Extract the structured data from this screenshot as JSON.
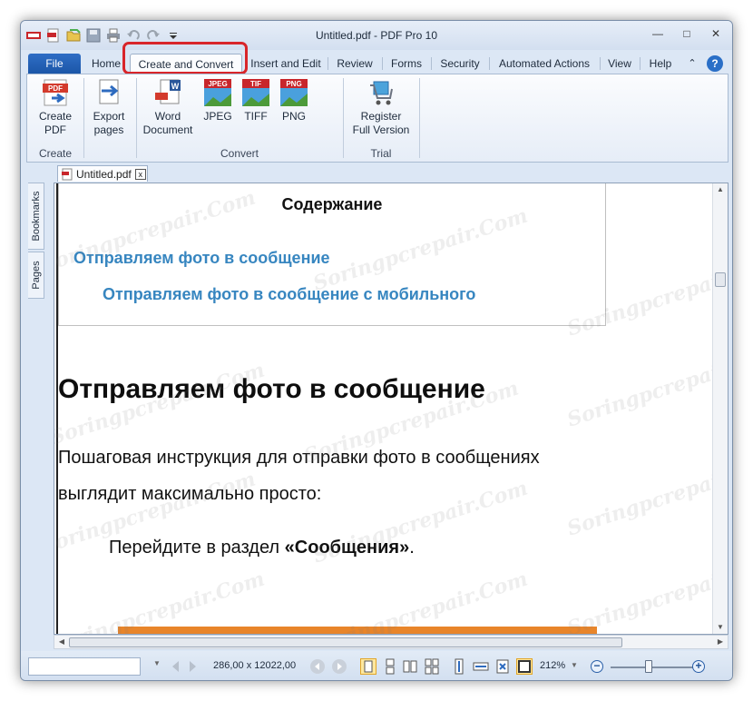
{
  "window": {
    "title": "Untitled.pdf - PDF Pro 10",
    "controls": {
      "minimize": "—",
      "restore": "□",
      "close": "✕"
    }
  },
  "quick_access": {
    "icons": [
      "app-menu-icon",
      "new-pdf-icon",
      "open-folder-icon",
      "save-icon",
      "print-icon",
      "undo-icon",
      "redo-icon",
      "customize-dropdown-icon"
    ]
  },
  "ribbon_tabs": {
    "file": "File",
    "home": "Home",
    "create_convert": "Create and Convert",
    "insert_edit": "Insert and Edit",
    "review": "Review",
    "forms": "Forms",
    "security": "Security",
    "automated_actions": "Automated Actions",
    "view": "View",
    "help": "Help",
    "collapse": "⌃",
    "help_icon": "?"
  },
  "ribbon": {
    "create_group": {
      "label": "Create",
      "create_pdf": "Create\nPDF",
      "export_pages": "Export\npages"
    },
    "convert_group": {
      "label": "Convert",
      "word": "Word\nDocument",
      "jpeg": "JPEG",
      "tiff": "TIFF",
      "png": "PNG",
      "jpeg_badge": "JPEG",
      "tiff_badge": "TIF",
      "png_badge": "PNG",
      "word_badge": "W",
      "pdf_badge": "PDF"
    },
    "trial_group": {
      "label": "Trial",
      "register": "Register\nFull Version"
    }
  },
  "side_tabs": {
    "bookmarks": "Bookmarks",
    "pages": "Pages"
  },
  "document_tab": {
    "name": "Untitled.pdf",
    "close": "x"
  },
  "document": {
    "toc_title": "Содержание",
    "toc_link_1": "Отправляем фото в сообщение",
    "toc_link_2": "Отправляем фото в сообщение с мобильного",
    "heading": "Отправляем фото в сообщение",
    "paragraph": "Пошаговая инструкция для отправки фото в сообщениях выглядит максимально просто:",
    "step_prefix": "Перейдите в раздел ",
    "step_bold": "«Сообщения»",
    "step_suffix": "."
  },
  "status_bar": {
    "page_input": "",
    "dimensions": "286,00 x 12022,00",
    "zoom_percent": "212%",
    "zoom_out": "−",
    "zoom_in": "+",
    "zoom_level_fraction": 0.4
  },
  "watermark_text": "Soringpcrepair.Com",
  "colors": {
    "accent_red": "#d8252a",
    "link_blue": "#3786c0",
    "file_tab": "#1b56a8"
  }
}
